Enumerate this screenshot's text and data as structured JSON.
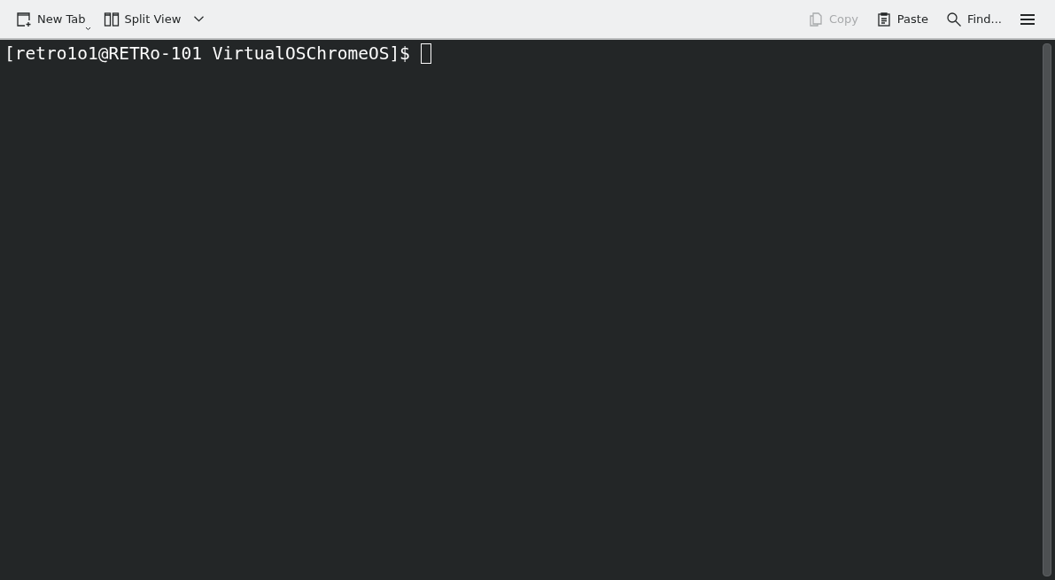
{
  "toolbar": {
    "left": [
      {
        "kind": "new-tab",
        "label": "New Tab",
        "disabled": false
      },
      {
        "kind": "split-view",
        "label": "Split View",
        "disabled": false
      }
    ],
    "right": [
      {
        "kind": "copy",
        "label": "Copy",
        "disabled": true
      },
      {
        "kind": "paste",
        "label": "Paste",
        "disabled": false
      },
      {
        "kind": "find",
        "label": "Find...",
        "disabled": false
      },
      {
        "kind": "menu",
        "disabled": false
      }
    ]
  },
  "terminal": {
    "lines": [
      "[retro1o1@RETRo-101 VirtualOSChromeOS]$"
    ]
  }
}
